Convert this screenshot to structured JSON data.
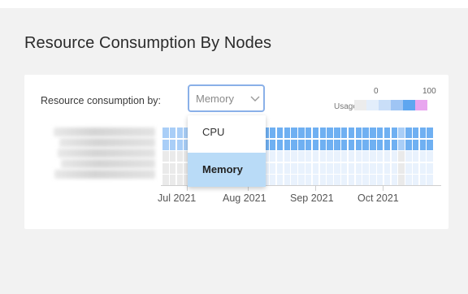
{
  "page": {
    "title": "Resource Consumption By Nodes"
  },
  "filter": {
    "label": "Resource consumption by:",
    "selected_value": "Memory",
    "options": [
      "CPU",
      "Memory"
    ],
    "chevron_icon": "chevron-down-icon"
  },
  "legend": {
    "title": "Usage %",
    "min": "0",
    "max": "100",
    "colors": [
      "#ececec",
      "#e3eefb",
      "#c9def8",
      "#9fc5f4",
      "#5ea6f0",
      "#e8a6ef"
    ]
  },
  "heatmap": {
    "rows": 5,
    "columns": 38,
    "node_names_blurred": true,
    "months": [
      "Jul 2021",
      "Aug 2021",
      "Sep 2021",
      "Oct 2021"
    ],
    "colors": {
      "high": "#6fb0f2",
      "mid": "#a9cef7",
      "low": "#e9f2fd",
      "none": "#eaeaea"
    }
  }
}
